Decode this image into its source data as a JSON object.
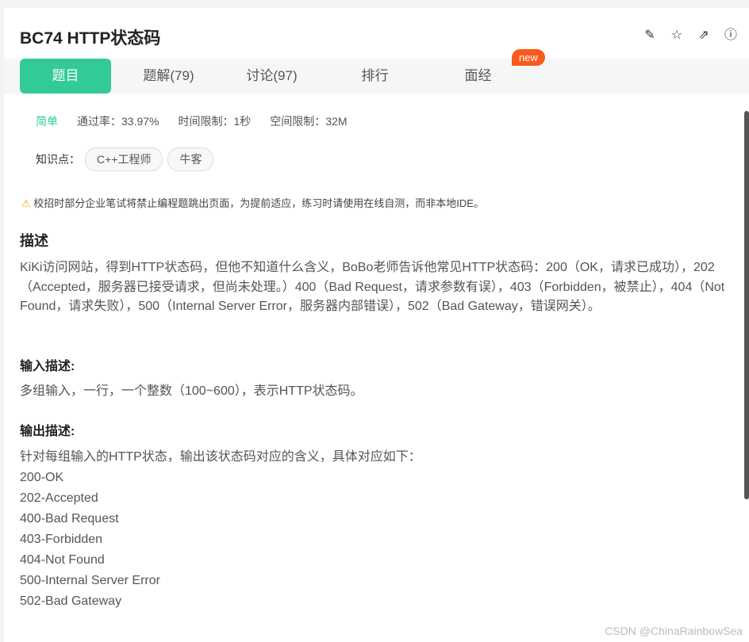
{
  "title": "BC74  HTTP状态码",
  "tabs": [
    "题目",
    "题解(79)",
    "讨论(97)",
    "排行",
    "面经"
  ],
  "new_badge": "new",
  "meta": {
    "level": "简单",
    "pass_rate": "通过率：33.97%",
    "time_limit": "时间限制：1秒",
    "space_limit": "空间限制：32M"
  },
  "knowledge": {
    "label": "知识点：",
    "tags": [
      "C++工程师",
      "牛客"
    ]
  },
  "warning": "校招时部分企业笔试将禁止编程题跳出页面，为提前适应，练习时请使用在线自测，而非本地IDE。",
  "desc": {
    "title": "描述",
    "text": "KiKi访问网站，得到HTTP状态码，但他不知道什么含义，BoBo老师告诉他常见HTTP状态码：200（OK，请求已成功），202（Accepted，服务器已接受请求，但尚未处理。）400（Bad Request，请求参数有误），403（Forbidden，被禁止），404（Not Found，请求失败），500（Internal Server Error，服务器内部错误），502（Bad Gateway，错误网关）。"
  },
  "input": {
    "title": "输入描述:",
    "text": "多组输入，一行，一个整数（100~600），表示HTTP状态码。"
  },
  "output": {
    "title": "输出描述:",
    "lines": [
      "针对每组输入的HTTP状态，输出该状态码对应的含义，具体对应如下：",
      "200-OK",
      "202-Accepted",
      "400-Bad Request",
      "403-Forbidden",
      "404-Not Found",
      "500-Internal Server Error",
      "502-Bad Gateway"
    ]
  },
  "watermark": "CSDN @ChinaRainbowSea"
}
